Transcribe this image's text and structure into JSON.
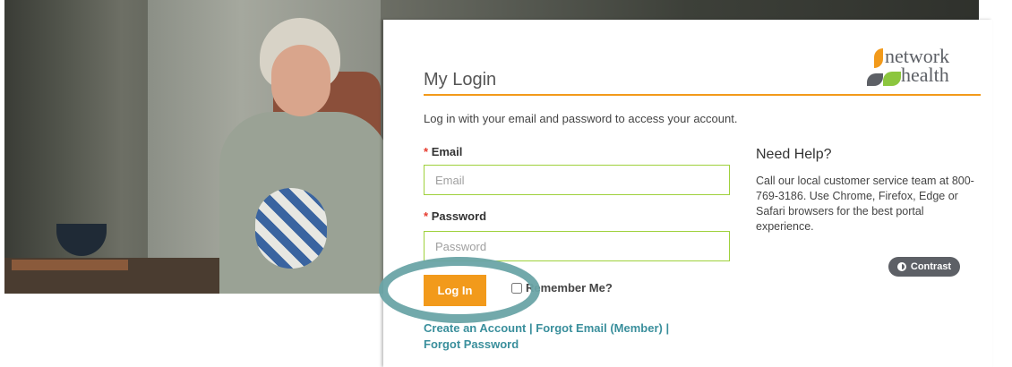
{
  "login": {
    "title": "My Login",
    "intro": "Log in with your email and password to access your account.",
    "email_label": "Email",
    "email_placeholder": "Email",
    "password_label": "Password",
    "password_placeholder": "Password",
    "login_button": "Log In",
    "remember_label": "Remember Me?",
    "required_mark": "*"
  },
  "links": {
    "create_account": "Create an Account",
    "forgot_email": "Forgot Email (Member)",
    "forgot_password": "Forgot Password",
    "separator": "|"
  },
  "help": {
    "heading": "Need Help?",
    "text": "Call our local customer service team at 800-769-3186. Use Chrome, Firefox, Edge or Safari browsers for the best portal experience."
  },
  "contrast_button": "Contrast",
  "logo": {
    "line1": "network",
    "line2": "health"
  },
  "colors": {
    "accent": "#f29a1b",
    "field_border": "#9fd13c",
    "link": "#3a8f9c",
    "highlight_ring": "#6aa4a6"
  }
}
